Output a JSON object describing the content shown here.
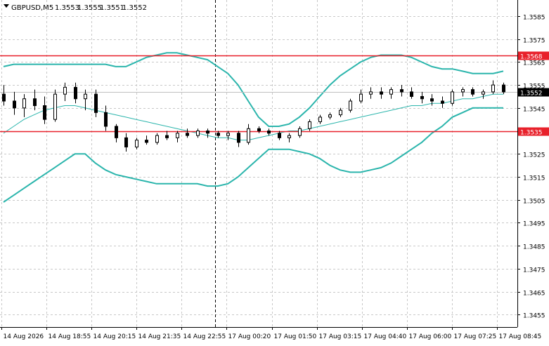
{
  "chart_data": {
    "type": "candlestick",
    "symbol_label": "GBPUSD,M5",
    "ohlc_readout": [
      "1.3553",
      "1.3555",
      "1.3551",
      "1.3552"
    ],
    "y_axis": {
      "ticks": [
        "1.3585",
        "1.3575",
        "1.3565",
        "1.3555",
        "1.3545",
        "1.3525",
        "1.3515",
        "1.3505",
        "1.3495",
        "1.3485",
        "1.3475",
        "1.3465",
        "1.3455"
      ],
      "range": [
        1.34496,
        1.3592
      ]
    },
    "x_axis": {
      "ticks": [
        "14 Aug 2026",
        "14 Aug 18:55",
        "14 Aug 20:15",
        "14 Aug 21:35",
        "14 Aug 22:55",
        "17 Aug 00:20",
        "17 Aug 01:50",
        "17 Aug 03:15",
        "17 Aug 04:40",
        "17 Aug 06:00",
        "17 Aug 07:25",
        "17 Aug 08:45"
      ]
    },
    "grid": true,
    "session_separator_after_label": "14 Aug 22:55",
    "horizontal_levels": [
      {
        "label": "1.3568",
        "value": 1.3568,
        "color": "#e8212b"
      },
      {
        "label": "1.3535",
        "value": 1.3535,
        "color": "#e8212b"
      }
    ],
    "current_price": {
      "label": "1.3552",
      "value": 1.3552
    },
    "bollinger": {
      "color": "#2bb5ac",
      "upper": [
        1.3563,
        1.3564,
        1.3564,
        1.3564,
        1.3564,
        1.3564,
        1.3564,
        1.3564,
        1.3564,
        1.3564,
        1.3564,
        1.3563,
        1.3563,
        1.3565,
        1.3567,
        1.3568,
        1.3569,
        1.3569,
        1.3568,
        1.3567,
        1.3566,
        1.3563,
        1.356,
        1.3555,
        1.3548,
        1.3541,
        1.3537,
        1.3537,
        1.3538,
        1.3541,
        1.3545,
        1.355,
        1.3555,
        1.3559,
        1.3562,
        1.3565,
        1.3567,
        1.3568,
        1.3568,
        1.3568,
        1.3567,
        1.3565,
        1.3563,
        1.3562,
        1.3562,
        1.3561,
        1.356,
        1.356,
        1.356,
        1.3561
      ],
      "middle": [
        1.3534,
        1.3537,
        1.354,
        1.3542,
        1.3544,
        1.3545,
        1.3546,
        1.3546,
        1.3545,
        1.3544,
        1.3543,
        1.3542,
        1.3541,
        1.354,
        1.3539,
        1.3538,
        1.3537,
        1.3536,
        1.3535,
        1.3534,
        1.3533,
        1.3532,
        1.3532,
        1.3531,
        1.3531,
        1.3532,
        1.3533,
        1.3534,
        1.3535,
        1.3535,
        1.3536,
        1.3537,
        1.3538,
        1.3539,
        1.354,
        1.3541,
        1.3542,
        1.3543,
        1.3544,
        1.3545,
        1.3546,
        1.3546,
        1.3547,
        1.3547,
        1.3548,
        1.3549,
        1.3549,
        1.355,
        1.3551,
        1.3551
      ],
      "lower": [
        1.3504,
        1.3507,
        1.351,
        1.3513,
        1.3516,
        1.3519,
        1.3522,
        1.3525,
        1.3525,
        1.3521,
        1.3518,
        1.3516,
        1.3515,
        1.3514,
        1.3513,
        1.3512,
        1.3512,
        1.3512,
        1.3512,
        1.3512,
        1.3511,
        1.3511,
        1.3512,
        1.3515,
        1.3519,
        1.3523,
        1.3527,
        1.3527,
        1.3527,
        1.3526,
        1.3525,
        1.3523,
        1.352,
        1.3518,
        1.3517,
        1.3517,
        1.3518,
        1.3519,
        1.3521,
        1.3524,
        1.3527,
        1.353,
        1.3534,
        1.3537,
        1.3541,
        1.3543,
        1.3545,
        1.3545,
        1.3545,
        1.3545
      ]
    },
    "candles": [
      {
        "o": 1.3551,
        "h": 1.3555,
        "l": 1.3546,
        "c": 1.3548
      },
      {
        "o": 1.3548,
        "h": 1.3552,
        "l": 1.3542,
        "c": 1.3545
      },
      {
        "o": 1.3545,
        "h": 1.3551,
        "l": 1.3541,
        "c": 1.3549
      },
      {
        "o": 1.3549,
        "h": 1.3553,
        "l": 1.3544,
        "c": 1.3546
      },
      {
        "o": 1.3546,
        "h": 1.355,
        "l": 1.3538,
        "c": 1.354
      },
      {
        "o": 1.354,
        "h": 1.3553,
        "l": 1.3539,
        "c": 1.3551
      },
      {
        "o": 1.3551,
        "h": 1.3556,
        "l": 1.3548,
        "c": 1.3554
      },
      {
        "o": 1.3554,
        "h": 1.3556,
        "l": 1.3547,
        "c": 1.3549
      },
      {
        "o": 1.3549,
        "h": 1.3553,
        "l": 1.3544,
        "c": 1.3551
      },
      {
        "o": 1.3551,
        "h": 1.3553,
        "l": 1.3541,
        "c": 1.3543
      },
      {
        "o": 1.3543,
        "h": 1.3546,
        "l": 1.3535,
        "c": 1.3537
      },
      {
        "o": 1.3537,
        "h": 1.3538,
        "l": 1.353,
        "c": 1.3532
      },
      {
        "o": 1.3532,
        "h": 1.3534,
        "l": 1.3526,
        "c": 1.3528
      },
      {
        "o": 1.3528,
        "h": 1.3532,
        "l": 1.3527,
        "c": 1.3531
      },
      {
        "o": 1.3531,
        "h": 1.3533,
        "l": 1.3529,
        "c": 1.353
      },
      {
        "o": 1.353,
        "h": 1.3534,
        "l": 1.3529,
        "c": 1.3533
      },
      {
        "o": 1.3533,
        "h": 1.3535,
        "l": 1.3531,
        "c": 1.3532
      },
      {
        "o": 1.3532,
        "h": 1.3535,
        "l": 1.353,
        "c": 1.3534
      },
      {
        "o": 1.3534,
        "h": 1.3536,
        "l": 1.3532,
        "c": 1.3533
      },
      {
        "o": 1.3533,
        "h": 1.3536,
        "l": 1.3532,
        "c": 1.3535
      },
      {
        "o": 1.3535,
        "h": 1.3536,
        "l": 1.3532,
        "c": 1.3534
      },
      {
        "o": 1.3534,
        "h": 1.3535,
        "l": 1.3532,
        "c": 1.3533
      },
      {
        "o": 1.3533,
        "h": 1.3535,
        "l": 1.3531,
        "c": 1.3534
      },
      {
        "o": 1.3534,
        "h": 1.3535,
        "l": 1.3528,
        "c": 1.353
      },
      {
        "o": 1.353,
        "h": 1.3538,
        "l": 1.3529,
        "c": 1.3536
      },
      {
        "o": 1.3536,
        "h": 1.3537,
        "l": 1.3534,
        "c": 1.3535
      },
      {
        "o": 1.3535,
        "h": 1.3536,
        "l": 1.3533,
        "c": 1.3534
      },
      {
        "o": 1.3534,
        "h": 1.3535,
        "l": 1.3531,
        "c": 1.3532
      },
      {
        "o": 1.3532,
        "h": 1.3534,
        "l": 1.353,
        "c": 1.3533
      },
      {
        "o": 1.3533,
        "h": 1.3537,
        "l": 1.3532,
        "c": 1.3536
      },
      {
        "o": 1.3536,
        "h": 1.354,
        "l": 1.3535,
        "c": 1.3539
      },
      {
        "o": 1.3539,
        "h": 1.3542,
        "l": 1.3538,
        "c": 1.3541
      },
      {
        "o": 1.3541,
        "h": 1.3543,
        "l": 1.354,
        "c": 1.3542
      },
      {
        "o": 1.3542,
        "h": 1.3545,
        "l": 1.3541,
        "c": 1.3544
      },
      {
        "o": 1.3544,
        "h": 1.3549,
        "l": 1.3543,
        "c": 1.3548
      },
      {
        "o": 1.3548,
        "h": 1.3553,
        "l": 1.3547,
        "c": 1.3551
      },
      {
        "o": 1.3551,
        "h": 1.3554,
        "l": 1.3549,
        "c": 1.3552
      },
      {
        "o": 1.3552,
        "h": 1.3554,
        "l": 1.3549,
        "c": 1.3551
      },
      {
        "o": 1.3551,
        "h": 1.3554,
        "l": 1.3549,
        "c": 1.3553
      },
      {
        "o": 1.3553,
        "h": 1.3555,
        "l": 1.355,
        "c": 1.3552
      },
      {
        "o": 1.3552,
        "h": 1.3554,
        "l": 1.3549,
        "c": 1.355
      },
      {
        "o": 1.355,
        "h": 1.3552,
        "l": 1.3547,
        "c": 1.3549
      },
      {
        "o": 1.3549,
        "h": 1.3551,
        "l": 1.3546,
        "c": 1.3548
      },
      {
        "o": 1.3548,
        "h": 1.355,
        "l": 1.3545,
        "c": 1.3547
      },
      {
        "o": 1.3547,
        "h": 1.3553,
        "l": 1.3546,
        "c": 1.3552
      },
      {
        "o": 1.3552,
        "h": 1.3554,
        "l": 1.355,
        "c": 1.3553
      },
      {
        "o": 1.3553,
        "h": 1.3554,
        "l": 1.355,
        "c": 1.3551
      },
      {
        "o": 1.3551,
        "h": 1.3553,
        "l": 1.3549,
        "c": 1.3552
      },
      {
        "o": 1.3552,
        "h": 1.3557,
        "l": 1.3551,
        "c": 1.3555
      },
      {
        "o": 1.3555,
        "h": 1.3556,
        "l": 1.3551,
        "c": 1.3552
      }
    ]
  }
}
